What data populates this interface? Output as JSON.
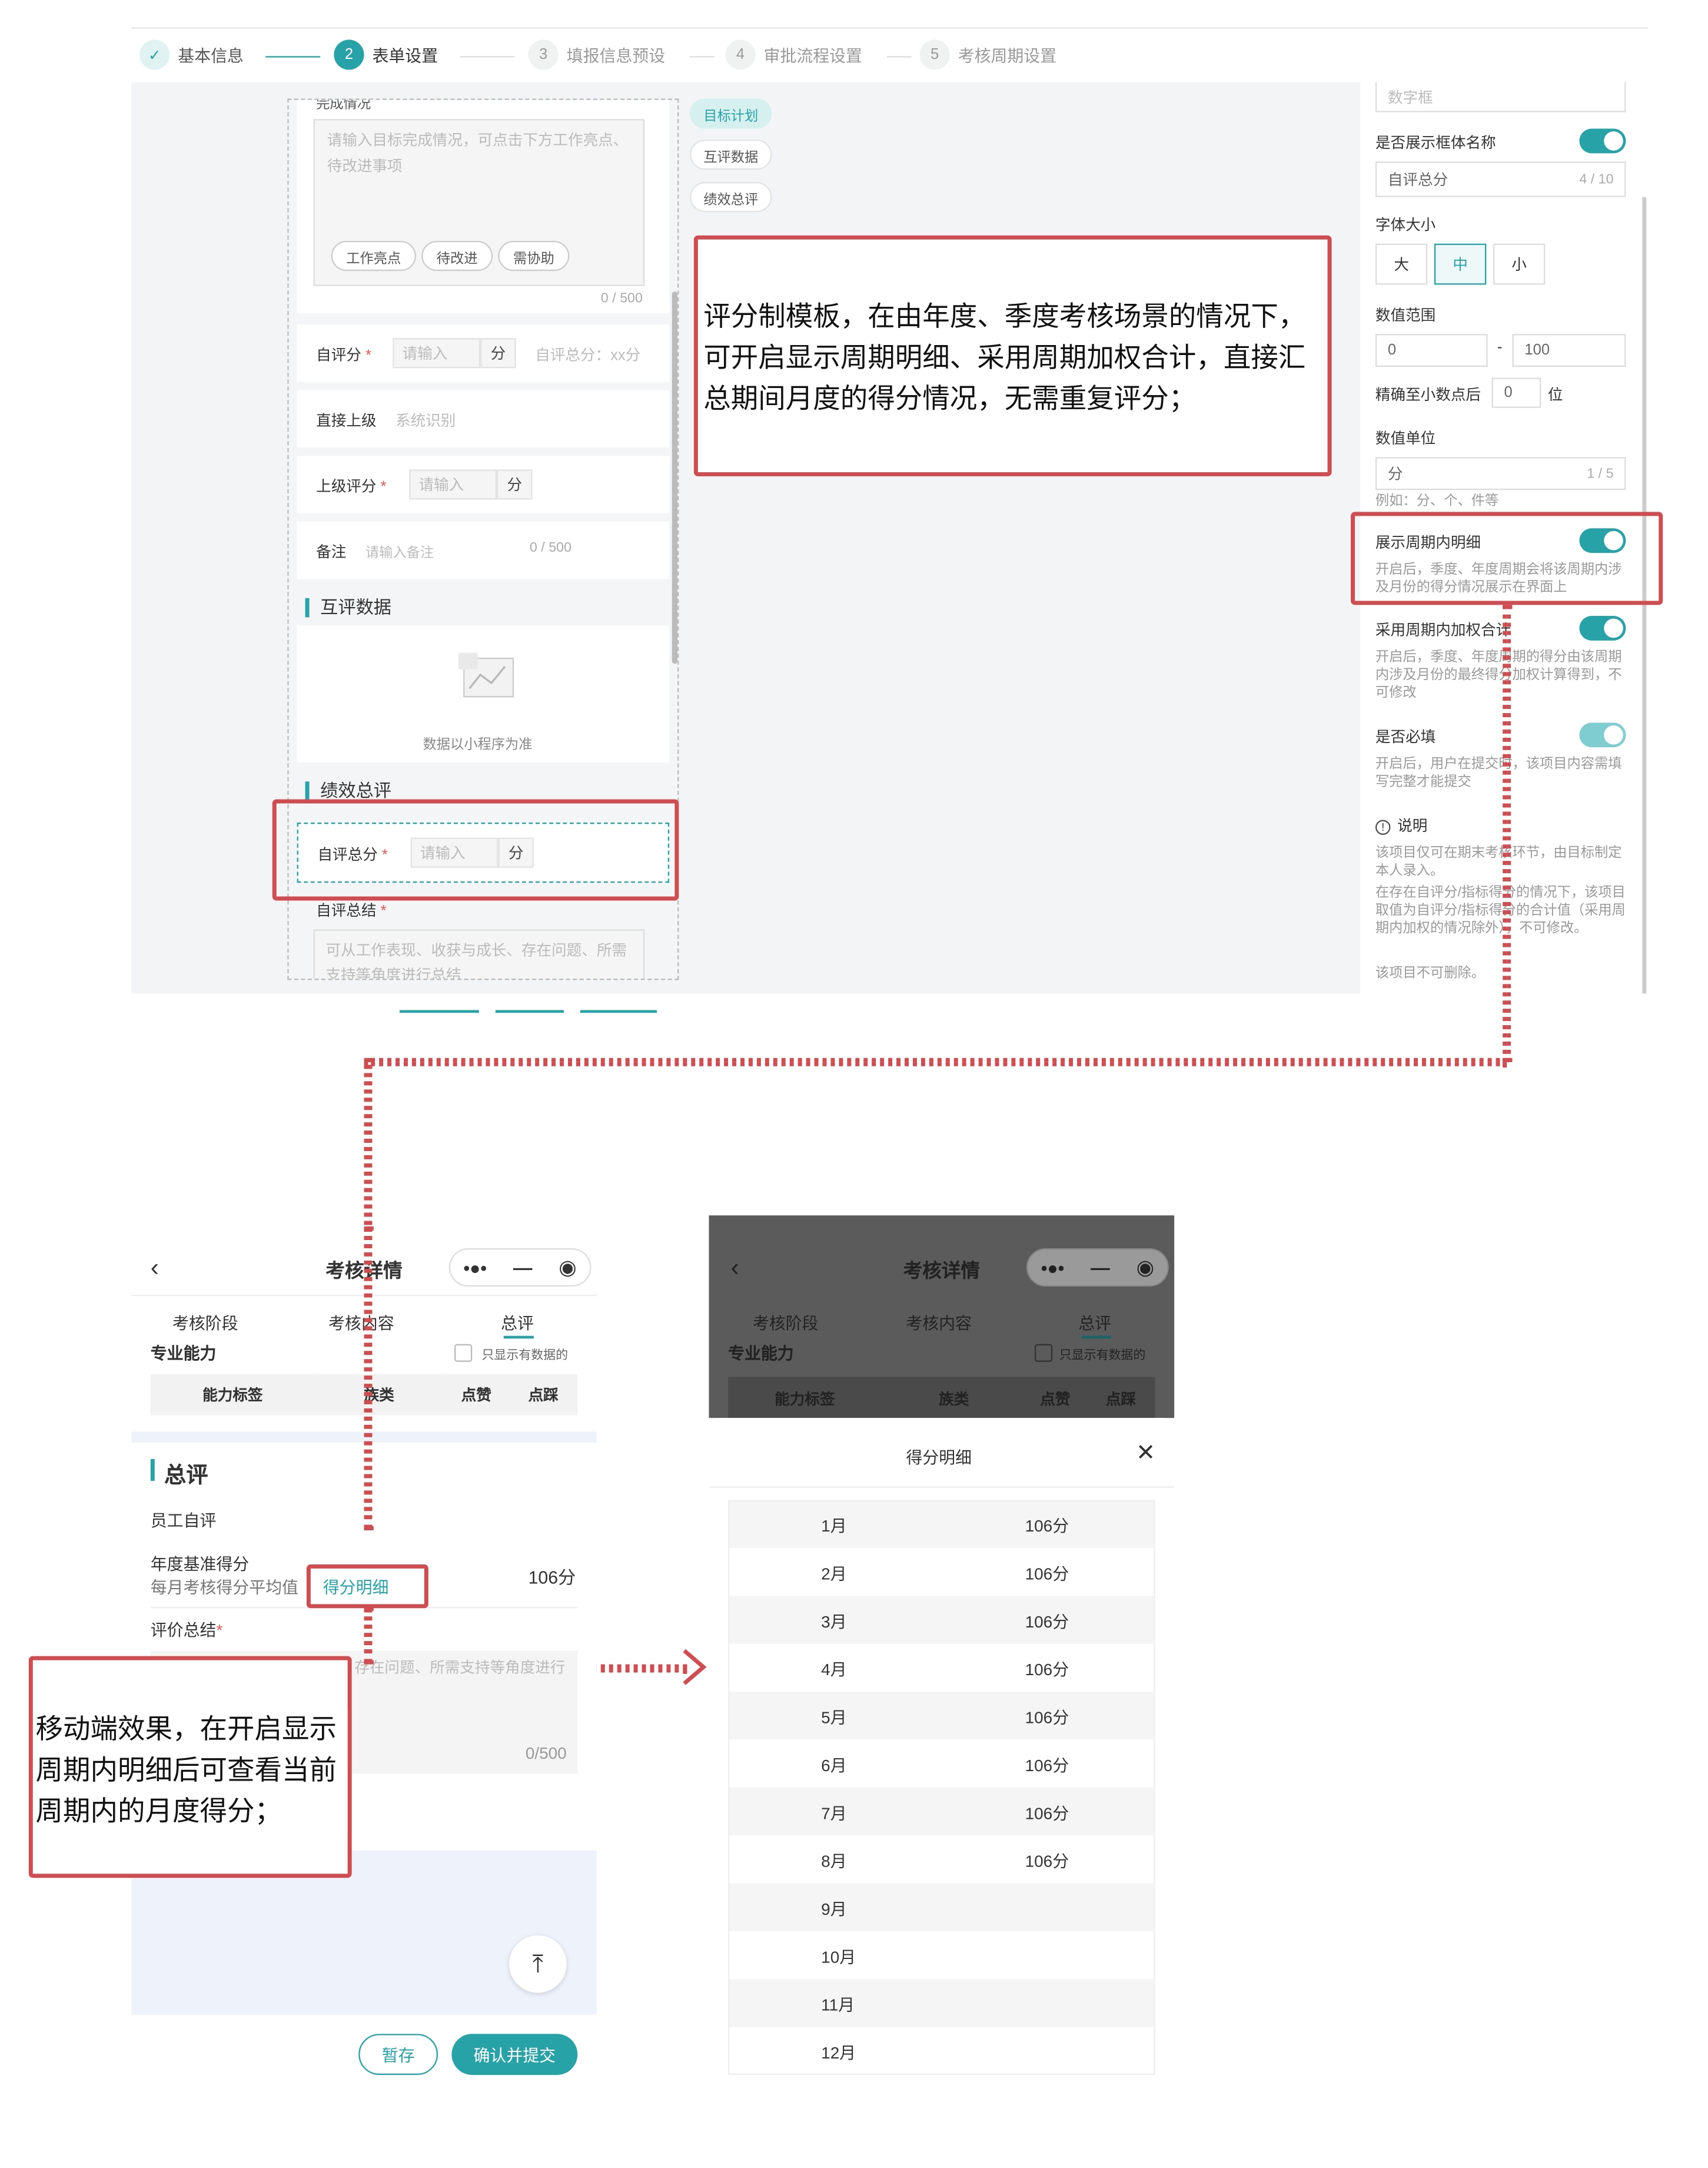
{
  "steps": [
    {
      "num": "✓",
      "label": "基本信息",
      "state": "done"
    },
    {
      "num": "2",
      "label": "表单设置",
      "state": "active"
    },
    {
      "num": "3",
      "label": "填报信息预设",
      "state": "todo"
    },
    {
      "num": "4",
      "label": "审批流程设置",
      "state": "todo"
    },
    {
      "num": "5",
      "label": "考核周期设置",
      "state": "todo"
    }
  ],
  "canvas": {
    "cut_title": "完成情况",
    "textarea_placeholder": "请输入目标完成情况，可点击下方工作亮点、待改进事项",
    "chips": [
      "工作亮点",
      "待改进",
      "需协助"
    ],
    "textarea_count": "0 / 500",
    "self_score_label": "自评分",
    "input_placeholder": "请输入",
    "unit": "分",
    "self_total_hint": "自评总分：xx分",
    "superior_label": "直接上级",
    "superior_value": "系统识别",
    "superior_score_label": "上级评分",
    "remark_label": "备注",
    "remark_placeholder": "请输入备注",
    "remark_count": "0 / 500",
    "peer_title": "互评数据",
    "peer_empty": "数据以小程序为准",
    "summary_title": "绩效总评",
    "self_total_label": "自评总分",
    "self_summary_label": "自评总结",
    "summary_placeholder": "可从工作表现、收获与成长、存在问题、所需支持等角度进行总结"
  },
  "component_tabs": [
    "目标计划",
    "互评数据",
    "绩效总评"
  ],
  "annotation_top": "评分制模板，在由年度、季度考核场景的情况下，可开启显示周期明细、采用周期加权合计，直接汇总期间月度的得分情况，无需重复评分；",
  "panel": {
    "number_box": "数字框",
    "show_title_label": "是否展示框体名称",
    "title_value": "自评总分",
    "title_count": "4 / 10",
    "font_size_label": "字体大小",
    "font_sizes": [
      "大",
      "中",
      "小"
    ],
    "range_label": "数值范围",
    "range_min": "0",
    "range_sep": "-",
    "range_max": "100",
    "decimal_label": "精确至小数点后",
    "decimal_value": "0",
    "decimal_unit": "位",
    "unit_label": "数值单位",
    "unit_value": "分",
    "unit_count": "1 / 5",
    "unit_example": "例如：分、个、件等",
    "cycle_detail_label": "展示周期内明细",
    "cycle_detail_desc": "开启后，季度、年度周期会将该周期内涉及月份的得分情况展示在界面上",
    "weighted_label": "采用周期内加权合计",
    "weighted_desc": "开启后，季度、年度周期的得分由该周期内涉及月份的最终得分加权计算得到，不可修改",
    "required_label": "是否必填",
    "required_desc": "开启后，用户在提交时，该项目内容需填写完整才能提交",
    "info_title": "说明",
    "info_lines": [
      "该项目仅可在期末考核环节，由目标制定本人录入。",
      "在存在自评分/指标得分的情况下，该项目取值为自评分/指标得分的合计值（采用周期内加权的情况除外），不可修改。",
      "该项目不可删除。"
    ]
  },
  "mobile": {
    "title": "考核详情",
    "tabs": [
      "考核阶段",
      "考核内容",
      "总评"
    ],
    "section": "专业能力",
    "checkbox_label": "只显示有数据的",
    "table_headers": [
      "能力标签",
      "族类",
      "点赞",
      "点踩"
    ],
    "summary_title": "总评",
    "self_eval": "员工自评",
    "annual_label": "年度基准得分",
    "annual_sub": "每月考核得分平均值",
    "detail_link": "得分明细",
    "annual_value": "106分",
    "comment_label": "评价总结",
    "comment_placeholder": "可从工作表现、收获与成长、存在问题、所需支持等角度进行总结",
    "comment_count": "0/500",
    "btn_save": "暂存",
    "btn_submit": "确认并提交"
  },
  "annotation_bottom": "移动端效果，在开启显示周期内明细后可查看当前周期内的月度得分；",
  "modal": {
    "title": "得分明细",
    "rows": [
      {
        "month": "1月",
        "score": "106分"
      },
      {
        "month": "2月",
        "score": "106分"
      },
      {
        "month": "3月",
        "score": "106分"
      },
      {
        "month": "4月",
        "score": "106分"
      },
      {
        "month": "5月",
        "score": "106分"
      },
      {
        "month": "6月",
        "score": "106分"
      },
      {
        "month": "7月",
        "score": "106分"
      },
      {
        "month": "8月",
        "score": "106分"
      },
      {
        "month": "9月",
        "score": ""
      },
      {
        "month": "10月",
        "score": ""
      },
      {
        "month": "11月",
        "score": ""
      },
      {
        "month": "12月",
        "score": ""
      }
    ]
  },
  "colors": {
    "accent": "#27a3a8",
    "annotation": "#cf4c50"
  }
}
